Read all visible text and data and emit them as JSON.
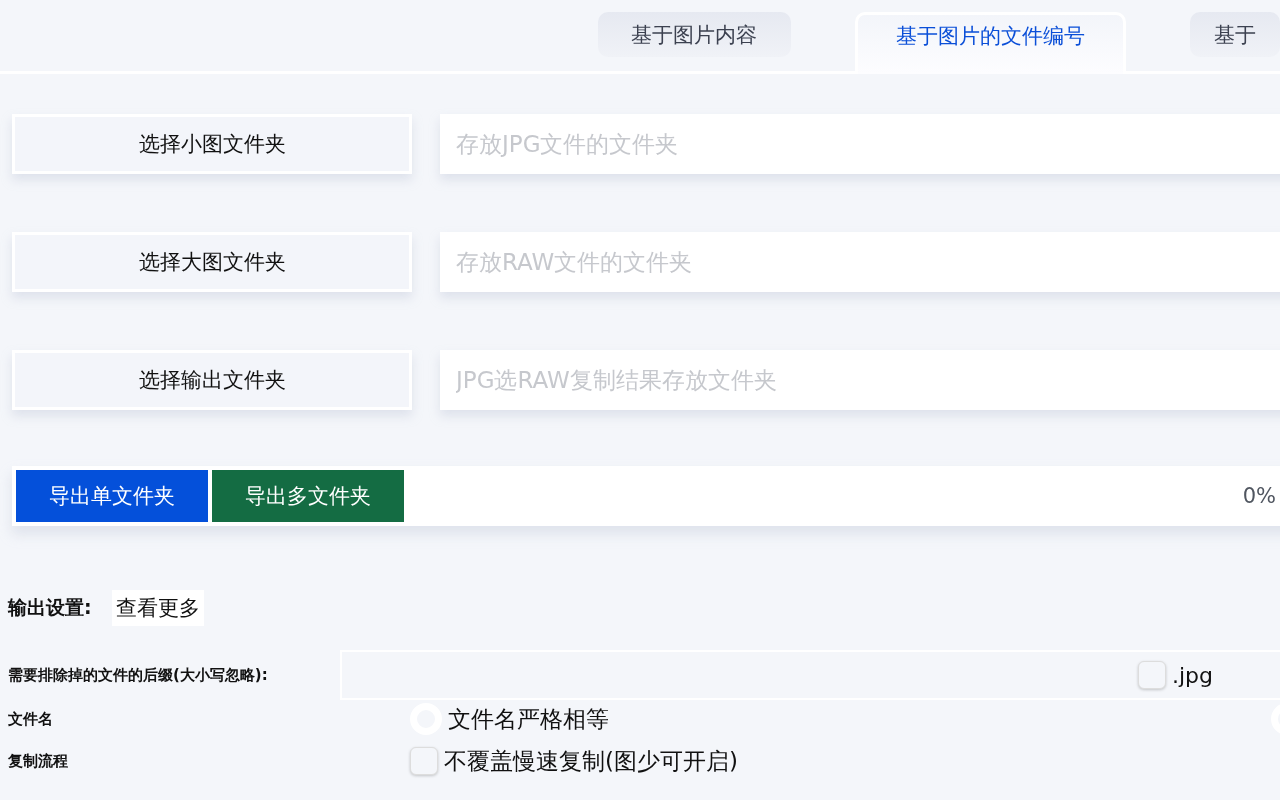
{
  "tabs": [
    {
      "label": "基于图片内容",
      "selected": false
    },
    {
      "label": "基于图片的文件编号",
      "selected": true
    },
    {
      "label": "基于",
      "selected": false
    }
  ],
  "folders": [
    {
      "button": "选择小图文件夹",
      "placeholder": "存放JPG文件的文件夹"
    },
    {
      "button": "选择大图文件夹",
      "placeholder": "存放RAW文件的文件夹"
    },
    {
      "button": "选择输出文件夹",
      "placeholder": "JPG选RAW复制结果存放文件夹"
    }
  ],
  "export": {
    "buttons": [
      {
        "label": "导出单文件夹",
        "kind": "primary"
      },
      {
        "label": "导出多文件夹",
        "kind": "success"
      }
    ],
    "progress": {
      "level": 0,
      "reading": "0%"
    }
  },
  "settings": {
    "title": "输出设置:",
    "more": "查看更多",
    "rows": [
      {
        "kind": "suffix",
        "label": "需要排除掉的文件的后缀(大小写忽略):",
        "options": [
          {
            "label": ".jpg",
            "checked": false
          }
        ]
      },
      {
        "kind": "radio",
        "label": "文件名",
        "options": [
          {
            "label": "文件名严格相等",
            "selected": false
          },
          {
            "selected": false
          }
        ]
      },
      {
        "kind": "check",
        "label": "复制流程",
        "options": [
          {
            "label": "不覆盖慢速复制(图少可开启)",
            "checked": false
          }
        ]
      }
    ]
  }
}
